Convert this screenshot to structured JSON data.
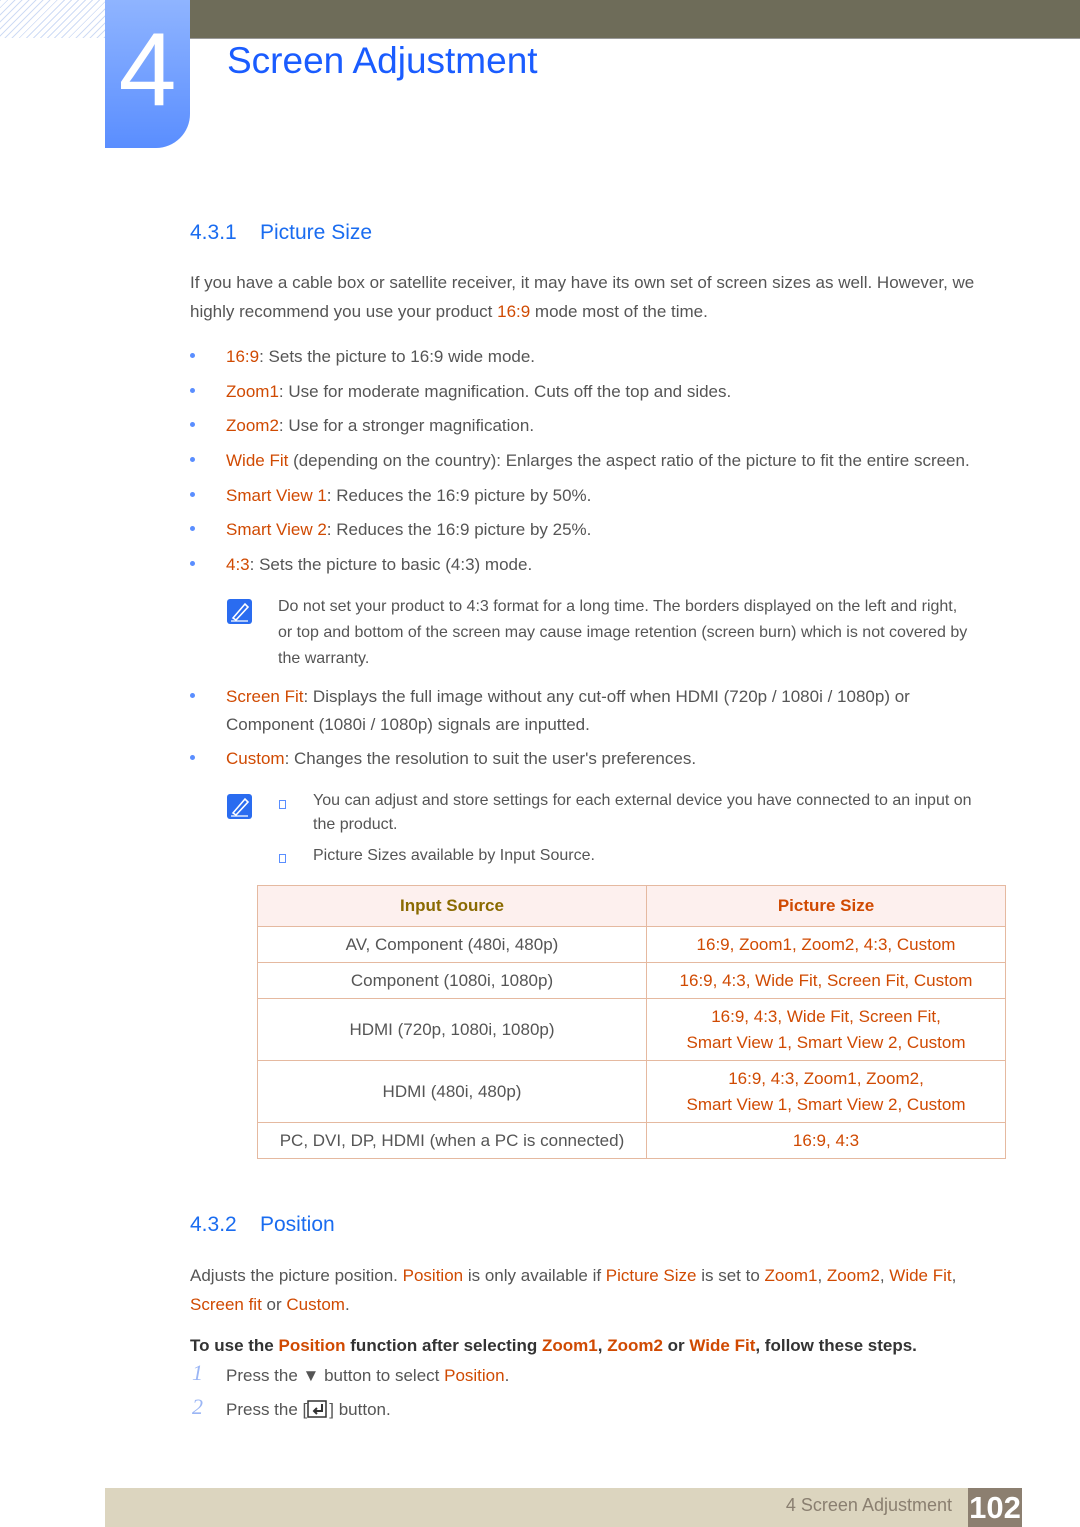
{
  "header": {
    "chapter_number": "4",
    "chapter_title": "Screen Adjustment"
  },
  "section1": {
    "number": "4.3.1",
    "title": "Picture Size",
    "intro": [
      {
        "t": "If you have a cable box or satellite receiver, it may have its own set of screen sizes as well. However, we"
      },
      {
        "t": "\nhighly recommend you use your product "
      },
      {
        "t": "16:9",
        "h": 1
      },
      {
        "t": " mode most of the time."
      }
    ],
    "bullets": [
      [
        {
          "t": "16:9",
          "h": 1
        },
        {
          "t": ": Sets the picture to 16:9 wide mode."
        }
      ],
      [
        {
          "t": "Zoom1",
          "h": 1
        },
        {
          "t": ": Use for moderate magnification. Cuts off the top and sides."
        }
      ],
      [
        {
          "t": "Zoom2",
          "h": 1
        },
        {
          "t": ": Use for a stronger magnification."
        }
      ],
      [
        {
          "t": "Wide Fit",
          "h": 1
        },
        {
          "t": " (depending on the country): Enlarges the aspect ratio of the picture to fit the entire screen."
        }
      ],
      [
        {
          "t": "Smart View 1",
          "h": 1
        },
        {
          "t": ": Reduces the 16:9 picture by 50%."
        }
      ],
      [
        {
          "t": "Smart View 2",
          "h": 1
        },
        {
          "t": ": Reduces the 16:9 picture by 25%."
        }
      ],
      [
        {
          "t": "4:3",
          "h": 1
        },
        {
          "t": ": Sets the picture to basic (4:3) mode."
        }
      ]
    ],
    "note1": [
      "Do not set your product to 4:3 format for a long time. The borders displayed on the left and right,",
      "or top and bottom of the screen may cause image retention (screen burn) which is not covered by",
      "the warranty."
    ],
    "bullets2": [
      [
        {
          "t": "Screen Fit",
          "h": 1
        },
        {
          "t": ": Displays the full image without any cut-off when HDMI (720p / 1080i / 1080p) or\nComponent (1080i / 1080p) signals are inputted."
        }
      ],
      [
        {
          "t": "Custom",
          "h": 1
        },
        {
          "t": ": Changes the resolution to suit the user's preferences."
        }
      ]
    ],
    "note2": [
      "You can adjust and store settings for each external device you have connected to an input on\nthe product.",
      "Picture Sizes available by Input Source."
    ],
    "table": {
      "headers": [
        "Input Source",
        "Picture Size"
      ],
      "rows": [
        [
          "AV, Component (480i, 480p)",
          "16:9, Zoom1, Zoom2, 4:3, Custom"
        ],
        [
          "Component (1080i, 1080p)",
          "16:9, 4:3, Wide Fit, Screen Fit, Custom"
        ],
        [
          "HDMI (720p, 1080i, 1080p)",
          "16:9, 4:3, Wide Fit, Screen Fit,\nSmart View 1, Smart View 2, Custom"
        ],
        [
          "HDMI (480i, 480p)",
          "16:9, 4:3, Zoom1, Zoom2,\nSmart View 1, Smart View 2, Custom"
        ],
        [
          "PC, DVI, DP, HDMI (when a PC is connected)",
          "16:9, 4:3"
        ]
      ]
    }
  },
  "section2": {
    "number": "4.3.2",
    "title": "Position",
    "intro": [
      {
        "t": "Adjusts the picture position. "
      },
      {
        "t": "Position",
        "h": 1
      },
      {
        "t": " is only available if "
      },
      {
        "t": "Picture Size",
        "h": 1
      },
      {
        "t": " is set to "
      },
      {
        "t": "Zoom1",
        "h": 1
      },
      {
        "t": ", "
      },
      {
        "t": "Zoom2",
        "h": 1
      },
      {
        "t": ", "
      },
      {
        "t": "Wide Fit",
        "h": 1
      },
      {
        "t": ","
      },
      {
        "t": "\n"
      },
      {
        "t": "Screen fit",
        "h": 1
      },
      {
        "t": " or "
      },
      {
        "t": "Custom",
        "h": 1
      },
      {
        "t": "."
      }
    ],
    "steps_heading": [
      {
        "t": "To use the "
      },
      {
        "t": "Position",
        "h": 1
      },
      {
        "t": " function after selecting "
      },
      {
        "t": "Zoom1",
        "h": 1
      },
      {
        "t": ", "
      },
      {
        "t": "Zoom2",
        "h": 1
      },
      {
        "t": " or "
      },
      {
        "t": "Wide Fit",
        "h": 1
      },
      {
        "t": ", follow these steps."
      }
    ],
    "steps": [
      {
        "n": "1",
        "text": [
          {
            "t": "Press the ▼ button to select "
          },
          {
            "t": "Position",
            "h": 1
          },
          {
            "t": "."
          }
        ]
      },
      {
        "n": "2",
        "before": "Press the [",
        "after": "] button."
      }
    ]
  },
  "footer": {
    "label": "4 Screen Adjustment",
    "page": "102"
  },
  "colors": {
    "accent": "#d04a02",
    "heading": "#1a5cff",
    "footer_bg": "#dcd5bf",
    "page_box": "#8c7f70"
  }
}
